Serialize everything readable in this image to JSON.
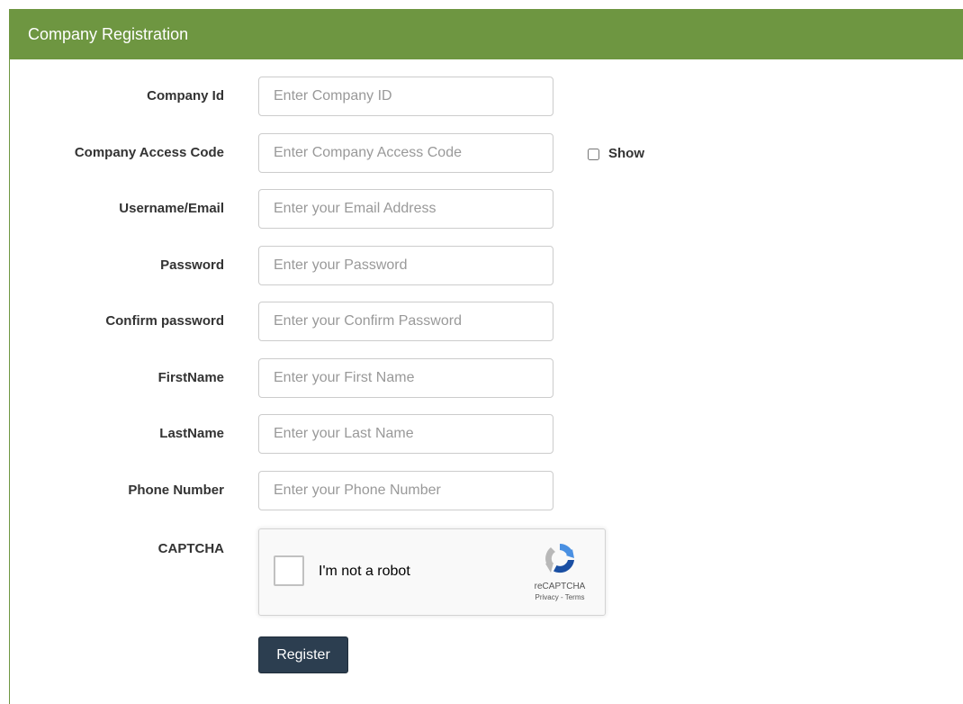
{
  "panel": {
    "title": "Company Registration",
    "header_color": "#6e9641"
  },
  "fields": [
    {
      "label": "Company Id",
      "placeholder": "Enter Company ID",
      "value": ""
    },
    {
      "label": "Company Access Code",
      "placeholder": "Enter Company Access Code",
      "value": ""
    },
    {
      "label": "Username/Email",
      "placeholder": "Enter your Email Address",
      "value": ""
    },
    {
      "label": "Password",
      "placeholder": "Enter your Password",
      "value": ""
    },
    {
      "label": "Confirm password",
      "placeholder": "Enter your Confirm Password",
      "value": ""
    },
    {
      "label": "FirstName",
      "placeholder": "Enter your First Name",
      "value": ""
    },
    {
      "label": "LastName",
      "placeholder": "Enter your Last Name",
      "value": ""
    },
    {
      "label": "Phone Number",
      "placeholder": "Enter your Phone Number",
      "value": ""
    }
  ],
  "show_toggle": {
    "label": "Show",
    "checked": false
  },
  "captcha": {
    "label": "CAPTCHA",
    "checkbox_text": "I'm not a robot",
    "brand": "reCAPTCHA",
    "privacy_link": "Privacy",
    "separator": " - ",
    "terms_link": "Terms",
    "icon": "recaptcha-logo-icon"
  },
  "actions": {
    "register_label": "Register",
    "button_color": "#2c3e50"
  }
}
